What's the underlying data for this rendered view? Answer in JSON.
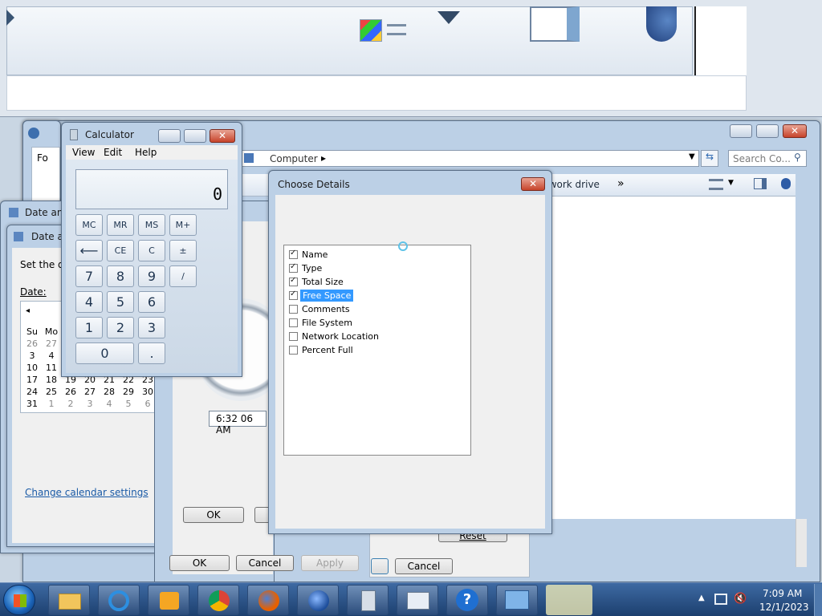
{
  "calculator": {
    "title": "Calculator",
    "menu": [
      "View",
      "Edit",
      "Help"
    ],
    "display": "0",
    "memory_keys": [
      "MC",
      "MR",
      "MS",
      "M+"
    ],
    "row2": [
      "⟵",
      "CE",
      "C",
      "±"
    ],
    "rows": [
      [
        "7",
        "8",
        "9",
        "/"
      ],
      [
        "4",
        "5",
        "6"
      ],
      [
        "1",
        "2",
        "3"
      ]
    ],
    "zero": "0",
    "dot": "."
  },
  "explorer": {
    "breadcrumb": "Computer",
    "search_placeholder": "Search Co...",
    "toolbar_network": "twork drive",
    "toolbar_more": "»"
  },
  "date_window": {
    "title_back": "Date and",
    "title_front": "Date ar",
    "set_label": "Set the d",
    "date_label": "Date:",
    "calendar_header": [
      "Su",
      "Mo"
    ],
    "calendar_rows": [
      [
        "26",
        "27",
        "",
        "",
        "",
        "",
        ""
      ],
      [
        "3",
        "4",
        "",
        "",
        "",
        "",
        ""
      ],
      [
        "10",
        "11",
        "",
        "",
        "",
        "",
        ""
      ],
      [
        "17",
        "18",
        "19",
        "20",
        "21",
        "22",
        "23"
      ],
      [
        "24",
        "25",
        "26",
        "27",
        "28",
        "29",
        "30"
      ],
      [
        "31",
        "1",
        "2",
        "3",
        "4",
        "5",
        "6"
      ]
    ],
    "time_value": "6:32 06 AM",
    "change_link": "Change calendar settings",
    "ok": "OK",
    "ok2": "OK",
    "cancel2": "Cancel",
    "apply2": "Apply",
    "cancel3": "Cancel",
    "reset": "Reset"
  },
  "dialog": {
    "title": "Choose Details",
    "items": [
      {
        "label": "Name",
        "checked": true
      },
      {
        "label": "Type",
        "checked": true
      },
      {
        "label": "Total Size",
        "checked": true
      },
      {
        "label": "Free Space",
        "checked": true
      },
      {
        "label": "Comments",
        "checked": false
      },
      {
        "label": "File System",
        "checked": false
      },
      {
        "label": "Network Location",
        "checked": false
      },
      {
        "label": "Percent Full",
        "checked": false
      }
    ]
  },
  "partial_windows": {
    "label_fo": "Fo"
  },
  "taskbar": {
    "time": "7:09 AM",
    "date": "12/1/2023",
    "colors": {
      "bar": "#1c3f6e",
      "accent": "#3399ff"
    }
  }
}
